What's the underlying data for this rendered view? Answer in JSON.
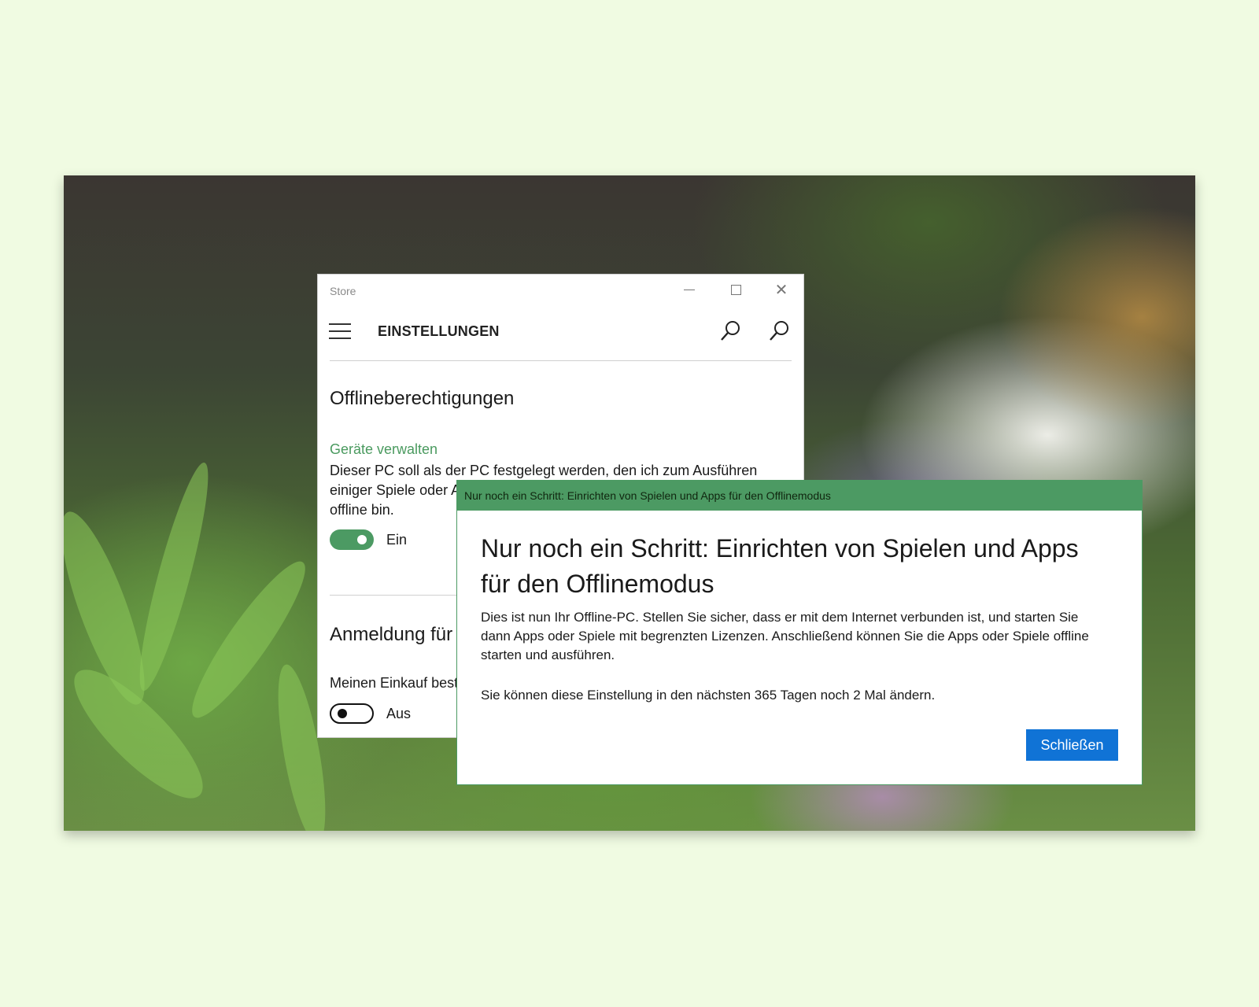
{
  "store_window": {
    "app_title": "Store",
    "page_title": "EINSTELLUNGEN",
    "offline_section": {
      "heading": "Offlineberechtigungen",
      "link": "Geräte verwalten",
      "description": "Dieser PC soll als der PC festgelegt werden, den ich zum Ausführen einiger Spiele oder Apps mit begrenzten Lizenzen verwende, wenn ich offline bin.",
      "toggle_label": "Ein",
      "toggle_on": true
    },
    "signin_section": {
      "heading": "Anmeldung für Einkäufe",
      "label": "Meinen Einkauf bestätigen",
      "toggle_label": "Aus",
      "toggle_on": false
    }
  },
  "dialog": {
    "window_title": "Nur noch ein Schritt: Einrichten von Spielen und Apps für den Offlinemodus",
    "heading": "Nur noch ein Schritt: Einrichten von Spielen und Apps für den Offlinemodus",
    "body": "Dies ist nun Ihr Offline-PC. Stellen Sie sicher, dass er mit dem Internet verbunden ist, und starten Sie dann Apps oder Spiele mit begrenzten Lizenzen. Anschließend können Sie die Apps oder Spiele offline starten und ausführen.",
    "note": "Sie können diese Einstellung in den nächsten 365 Tagen noch 2 Mal ändern.",
    "close_button": "Schließen"
  },
  "colors": {
    "accent_green": "#4c9a63",
    "button_blue": "#1073d6",
    "page_background": "#f0fbe2"
  },
  "icons": [
    "hamburger-menu-icon",
    "search-icon",
    "minimize-icon",
    "maximize-icon",
    "close-icon"
  ]
}
